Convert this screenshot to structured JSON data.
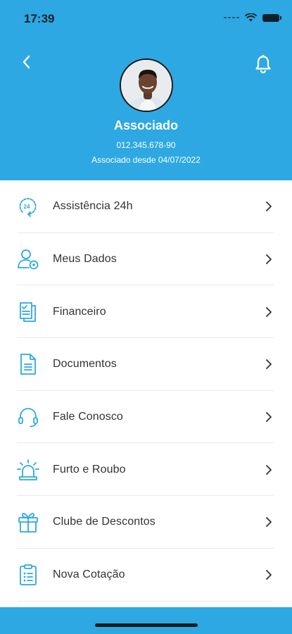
{
  "status_bar": {
    "time": "17:39"
  },
  "profile": {
    "name": "Associado",
    "cpf": "012.345.678-90",
    "member_since": "Associado desde 04/07/2022"
  },
  "menu": [
    {
      "label": "Assistência 24h",
      "icon": "assistance-24h-icon"
    },
    {
      "label": "Meus Dados",
      "icon": "user-settings-icon"
    },
    {
      "label": "Financeiro",
      "icon": "financial-checklist-icon"
    },
    {
      "label": "Documentos",
      "icon": "document-icon"
    },
    {
      "label": "Fale Conosco",
      "icon": "headset-icon"
    },
    {
      "label": "Furto e Roubo",
      "icon": "siren-icon"
    },
    {
      "label": "Clube de Descontos",
      "icon": "gift-icon"
    },
    {
      "label": "Nova Cotação",
      "icon": "clipboard-icon"
    }
  ],
  "colors": {
    "primary": "#2da8e2",
    "icon": "#2da8e2",
    "text": "#333333",
    "divider": "#e6e9ec"
  }
}
